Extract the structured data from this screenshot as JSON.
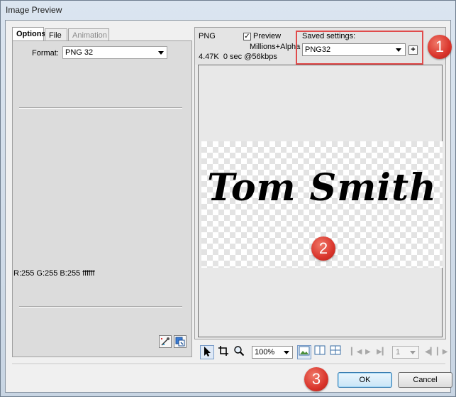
{
  "window": {
    "title": "Image Preview"
  },
  "tabs": [
    {
      "label": "Options",
      "active": true
    },
    {
      "label": "File",
      "active": false
    },
    {
      "label": "Animation",
      "active": false,
      "disabled": true
    }
  ],
  "options": {
    "format_label": "Format:",
    "format_value": "PNG 32",
    "color_readout": "R:255 G:255 B:255 ffffff"
  },
  "info": {
    "format": "PNG",
    "preview_label": "Preview",
    "preview_checked": "✓",
    "colors": "Millions+Alpha",
    "stats": "4.47K  0 sec @56kbps",
    "saved_settings_label": "Saved settings:",
    "saved_settings_value": "PNG32",
    "add_symbol": "+"
  },
  "preview": {
    "signature_text": "Tom Smith"
  },
  "callouts": {
    "one": "1",
    "two": "2",
    "three": "3"
  },
  "toolbar": {
    "zoom_value": "100%",
    "page_value": "1"
  },
  "buttons": {
    "ok": "OK",
    "cancel": "Cancel"
  },
  "colors": {
    "accent_red": "#d9342b",
    "highlight_border": "#e04b4b",
    "default_button": "#3c7fb1"
  },
  "icons": [
    "pointer-icon",
    "crop-icon",
    "zoom-icon",
    "single-view-icon",
    "two-up-view-icon",
    "four-up-view-icon",
    "first-frame-icon",
    "play-icon",
    "last-frame-icon",
    "prev-frame-icon",
    "next-frame-icon",
    "eyedropper-icon",
    "color-swap-icon"
  ]
}
